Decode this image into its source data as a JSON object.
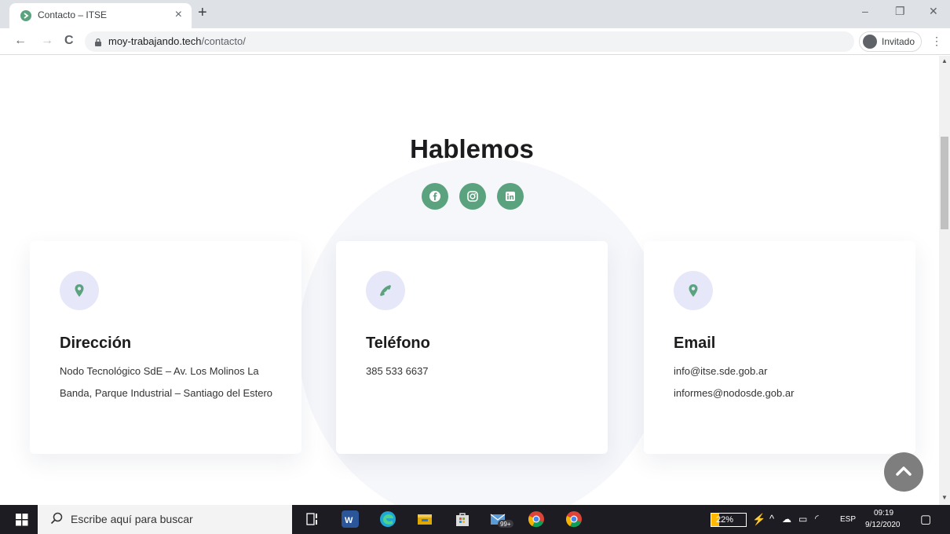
{
  "browser": {
    "tab_title": "Contacto – ITSE",
    "tab_close": "×",
    "new_tab": "+",
    "url_domain": "moy-trabajando.tech",
    "url_path": "/contacto/",
    "profile_label": "Invitado",
    "minimize": "–",
    "restore": "❐",
    "close": "✕",
    "back": "←",
    "forward": "→",
    "reload": "C",
    "menu": "⋮"
  },
  "page": {
    "title": "Hablemos",
    "social": [
      "facebook-icon",
      "instagram-icon",
      "linkedin-icon"
    ],
    "accent_color": "#5ba27e",
    "cards": [
      {
        "icon": "location-pin-icon",
        "title": "Dirección",
        "lines": [
          "Nodo Tecnológico SdE – Av. Los Molinos La Banda, Parque Industrial – Santiago del Estero"
        ]
      },
      {
        "icon": "phone-icon",
        "title": "Teléfono",
        "lines": [
          "385 533 6637"
        ]
      },
      {
        "icon": "location-pin-icon",
        "title": "Email",
        "lines": [
          "info@itse.sde.gob.ar",
          "informes@nodosde.gob.ar"
        ]
      }
    ]
  },
  "taskbar": {
    "search_placeholder": "Escribe aquí para buscar",
    "battery_percent": 22,
    "battery_label": "22%",
    "mail_badge": "99+",
    "language": "ESP",
    "time": "09:19",
    "date": "9/12/2020"
  }
}
